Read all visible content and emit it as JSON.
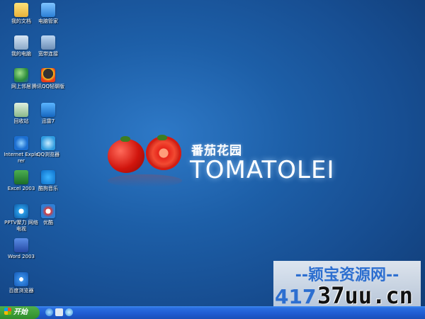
{
  "desktop": {
    "icons": [
      {
        "label": "我的文档",
        "icon": "folder-icon"
      },
      {
        "label": "电脑管家",
        "icon": "shield-icon"
      },
      {
        "label": "我的电脑",
        "icon": "computer-icon"
      },
      {
        "label": "宽带连接",
        "icon": "network-icon"
      },
      {
        "label": "网上邻居",
        "icon": "network-places-icon"
      },
      {
        "label": "腾讯QQ轻聊版",
        "icon": "qq-icon"
      },
      {
        "label": "回收站",
        "icon": "recycle-bin-icon"
      },
      {
        "label": "迅雷7",
        "icon": "xunlei-icon"
      },
      {
        "label": "Internet Explorer",
        "icon": "ie-icon"
      },
      {
        "label": "QQ浏览器",
        "icon": "qq-browser-icon"
      },
      {
        "label": "Excel 2003",
        "icon": "excel-icon"
      },
      {
        "label": "酷狗音乐",
        "icon": "kugou-icon"
      },
      {
        "label": "PPTV聚力 网络电视",
        "icon": "pptv-icon"
      },
      {
        "label": "优酷",
        "icon": "youku-icon"
      },
      {
        "label": "Word 2003",
        "icon": "word-icon"
      },
      {
        "label": "百度浏览器",
        "icon": "baidu-browser-icon"
      }
    ]
  },
  "wallpaper": {
    "brand_cn": "番茄花园",
    "brand_en": "TOMATOLEI"
  },
  "watermark": {
    "top": "--颖宝资源网--",
    "num": "417",
    "url": "37uu.cn"
  },
  "taskbar": {
    "start_label": "开始"
  }
}
